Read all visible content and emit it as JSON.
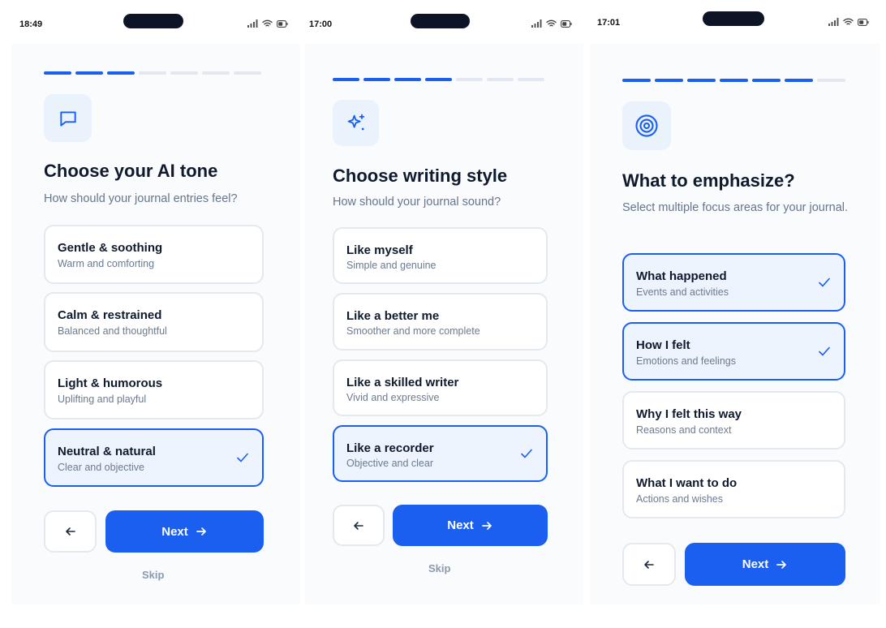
{
  "screens": [
    {
      "status": {
        "time": "18:49"
      },
      "progress": {
        "step": 3,
        "total": 7
      },
      "hero_icon": "chat-bubble-icon",
      "title": "Choose your AI tone",
      "subtitle": "How should your journal entries feel?",
      "options": [
        {
          "title": "Gentle & soothing",
          "subtitle": "Warm and comforting",
          "selected": false
        },
        {
          "title": "Calm & restrained",
          "subtitle": "Balanced and thoughtful",
          "selected": false
        },
        {
          "title": "Light & humorous",
          "subtitle": "Uplifting and playful",
          "selected": false
        },
        {
          "title": "Neutral & natural",
          "subtitle": "Clear and objective",
          "selected": true
        }
      ],
      "next_label": "Next",
      "skip_label": "Skip"
    },
    {
      "status": {
        "time": "17:00"
      },
      "progress": {
        "step": 4,
        "total": 7
      },
      "hero_icon": "sparkles-icon",
      "title": "Choose writing style",
      "subtitle": "How should your journal sound?",
      "options": [
        {
          "title": "Like myself",
          "subtitle": "Simple and genuine",
          "selected": false
        },
        {
          "title": "Like a better me",
          "subtitle": "Smoother and more complete",
          "selected": false
        },
        {
          "title": "Like a skilled writer",
          "subtitle": "Vivid and expressive",
          "selected": false
        },
        {
          "title": "Like a recorder",
          "subtitle": "Objective and clear",
          "selected": true
        }
      ],
      "next_label": "Next",
      "skip_label": "Skip"
    },
    {
      "status": {
        "time": "17:01"
      },
      "progress": {
        "step": 6,
        "total": 7
      },
      "hero_icon": "target-icon",
      "title": "What to emphasize?",
      "subtitle": "Select multiple focus areas for your journal.",
      "options": [
        {
          "title": "What happened",
          "subtitle": "Events and activities",
          "selected": true
        },
        {
          "title": "How I felt",
          "subtitle": "Emotions and feelings",
          "selected": true
        },
        {
          "title": "Why I felt this way",
          "subtitle": "Reasons and context",
          "selected": false
        },
        {
          "title": "What I want to do",
          "subtitle": "Actions and wishes",
          "selected": false
        }
      ],
      "next_label": "Next"
    }
  ],
  "colors": {
    "accent": "#1a5ff0",
    "selected_bg": "#edf4fd",
    "card_border": "#e4e9f0",
    "progress_inactive": "#e3e8f0",
    "hero_bg": "#eaf2fc"
  }
}
